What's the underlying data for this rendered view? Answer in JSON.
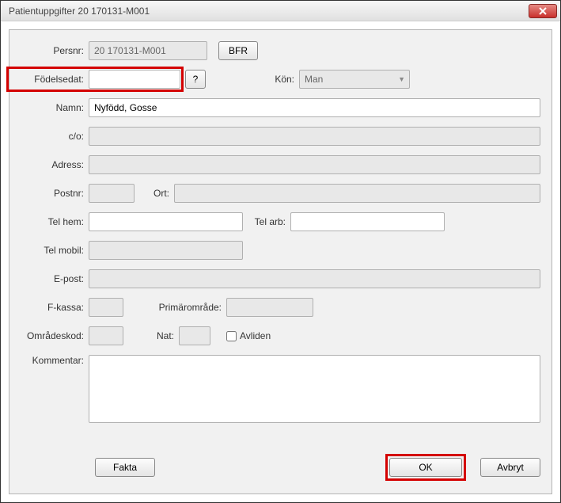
{
  "window": {
    "title": "Patientuppgifter 20 170131-M001"
  },
  "labels": {
    "persnr": "Persnr:",
    "bfr": "BFR",
    "fodelsedat": "Födelsedat:",
    "question": "?",
    "kon": "Kön:",
    "namn": "Namn:",
    "co": "c/o:",
    "adress": "Adress:",
    "postnr": "Postnr:",
    "ort": "Ort:",
    "telhem": "Tel hem:",
    "telarb": "Tel arb:",
    "telmobil": "Tel mobil:",
    "epost": "E-post:",
    "fkassa": "F-kassa:",
    "primaromrade": "Primärområde:",
    "omradeskod": "Områdeskod:",
    "nat": "Nat:",
    "avliden": "Avliden",
    "kommentar": "Kommentar:"
  },
  "values": {
    "persnr": "20 170131-M001",
    "fodelsedat": "",
    "kon": "Man",
    "namn": "Nyfödd, Gosse",
    "co": "",
    "adress": "",
    "postnr": "",
    "ort": "",
    "telhem": "",
    "telarb": "",
    "telmobil": "",
    "epost": "",
    "fkassa": "",
    "primaromrade": "",
    "omradeskod": "",
    "nat": "",
    "avliden": false,
    "kommentar": ""
  },
  "buttons": {
    "fakta": "Fakta",
    "ok": "OK",
    "avbryt": "Avbryt"
  }
}
